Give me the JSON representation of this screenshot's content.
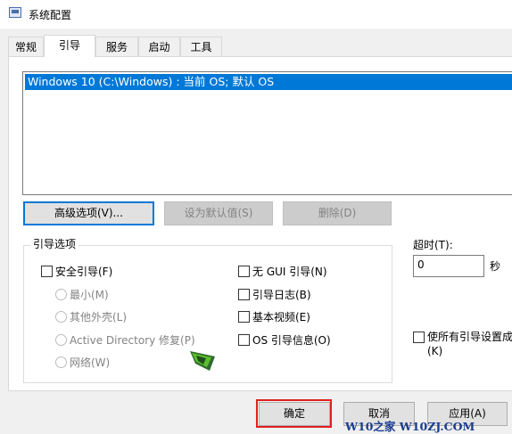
{
  "window": {
    "title": "系统配置"
  },
  "tabs": [
    "常规",
    "引导",
    "服务",
    "启动",
    "工具"
  ],
  "os_list": [
    "Windows 10 (C:\\Windows) : 当前 OS; 默认 OS"
  ],
  "os_buttons": {
    "advanced": "高级选项(V)...",
    "set_default": "设为默认值(S)",
    "delete": "删除(D)"
  },
  "boot_options": {
    "label": "引导选项",
    "safe_boot": "安全引导(F)",
    "minimal": "最小(M)",
    "alternate_shell": "其他外壳(L)",
    "ad_repair": "Active Directory 修复(P)",
    "network": "网络(W)",
    "no_gui": "无 GUI 引导(N)",
    "boot_log": "引导日志(B)",
    "base_video": "基本视频(E)",
    "os_info": "OS 引导信息(O)"
  },
  "timeout": {
    "label": "超时(T):",
    "value": "0",
    "unit": "秒"
  },
  "permanent": {
    "line1": "使所有引导设置成",
    "line2": "(K)"
  },
  "dialog_buttons": {
    "ok": "确定",
    "cancel": "取消",
    "apply": "应用(A)"
  },
  "watermark": "W10之家 W10ZJ.COM"
}
